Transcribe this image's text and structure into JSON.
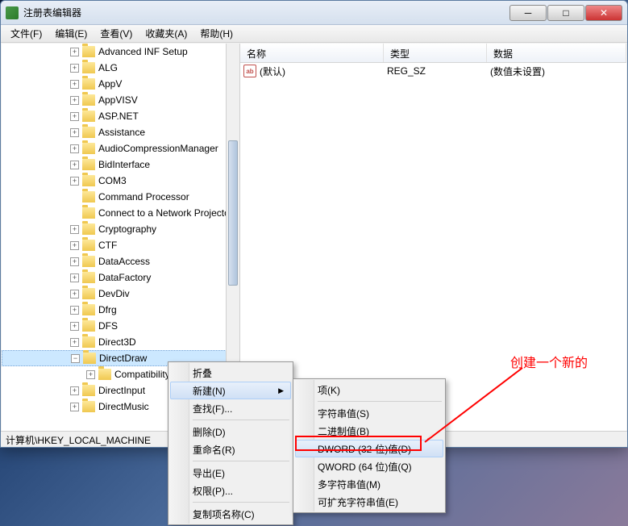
{
  "window": {
    "title": "注册表编辑器"
  },
  "menu": {
    "file": "文件(F)",
    "edit": "编辑(E)",
    "view": "查看(V)",
    "favorites": "收藏夹(A)",
    "help": "帮助(H)"
  },
  "tree": {
    "items": [
      {
        "label": "Advanced INF Setup",
        "exp": "+"
      },
      {
        "label": "ALG",
        "exp": "+"
      },
      {
        "label": "AppV",
        "exp": "+"
      },
      {
        "label": "AppVISV",
        "exp": "+"
      },
      {
        "label": "ASP.NET",
        "exp": "+"
      },
      {
        "label": "Assistance",
        "exp": "+"
      },
      {
        "label": "AudioCompressionManager",
        "exp": "+"
      },
      {
        "label": "BidInterface",
        "exp": "+"
      },
      {
        "label": "COM3",
        "exp": "+"
      },
      {
        "label": "Command Processor",
        "exp": ""
      },
      {
        "label": "Connect to a Network Projector",
        "exp": ""
      },
      {
        "label": "Cryptography",
        "exp": "+"
      },
      {
        "label": "CTF",
        "exp": "+"
      },
      {
        "label": "DataAccess",
        "exp": "+"
      },
      {
        "label": "DataFactory",
        "exp": "+"
      },
      {
        "label": "DevDiv",
        "exp": "+"
      },
      {
        "label": "Dfrg",
        "exp": "+"
      },
      {
        "label": "DFS",
        "exp": "+"
      },
      {
        "label": "Direct3D",
        "exp": "+"
      },
      {
        "label": "DirectDraw",
        "exp": "−",
        "selected": true
      },
      {
        "label": "Compatibility",
        "exp": "+",
        "child": true
      },
      {
        "label": "DirectInput",
        "exp": "+"
      },
      {
        "label": "DirectMusic",
        "exp": "+"
      }
    ]
  },
  "list": {
    "headers": {
      "name": "名称",
      "type": "类型",
      "data": "数据"
    },
    "row": {
      "name": "(默认)",
      "type": "REG_SZ",
      "data": "(数值未设置)"
    }
  },
  "context1": {
    "collapse": "折叠",
    "new": "新建(N)",
    "find": "查找(F)...",
    "delete": "删除(D)",
    "rename": "重命名(R)",
    "export": "导出(E)",
    "permissions": "权限(P)...",
    "copykey": "复制项名称(C)"
  },
  "context2": {
    "key": "项(K)",
    "string": "字符串值(S)",
    "binary": "二进制值(B)",
    "dword": "DWORD (32-位)值(D)",
    "qword": "QWORD (64 位)值(Q)",
    "multistring": "多字符串值(M)",
    "expandstring": "可扩充字符串值(E)"
  },
  "statusbar": "计算机\\HKEY_LOCAL_MACHINE",
  "annotation": "创建一个新的"
}
